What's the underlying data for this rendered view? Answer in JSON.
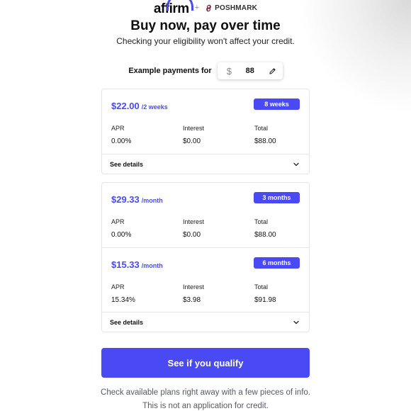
{
  "header": {
    "affirm_logo": "affirm",
    "plus": "+",
    "partner_logo": "POSHMARK",
    "title": "Buy now, pay over time",
    "subtitle": "Checking your eligibility won't affect your credit."
  },
  "example": {
    "label": "Example payments for",
    "currency_symbol": "$",
    "amount": "88"
  },
  "cards": [
    {
      "plans": [
        {
          "price": "$22.00",
          "period": "/2 weeks",
          "badge": "8 weeks",
          "apr_label": "APR",
          "apr": "0.00%",
          "interest_label": "Interest",
          "interest": "$0.00",
          "total_label": "Total",
          "total": "$88.00"
        }
      ],
      "details_label": "See details"
    },
    {
      "plans": [
        {
          "price": "$29.33",
          "period": "/month",
          "badge": "3 months",
          "apr_label": "APR",
          "apr": "0.00%",
          "interest_label": "Interest",
          "interest": "$0.00",
          "total_label": "Total",
          "total": "$88.00"
        },
        {
          "price": "$15.33",
          "period": "/month",
          "badge": "6 months",
          "apr_label": "APR",
          "apr": "15.34%",
          "interest_label": "Interest",
          "interest": "$3.98",
          "total_label": "Total",
          "total": "$91.98"
        }
      ],
      "details_label": "See details"
    }
  ],
  "cta": {
    "label": "See if you qualify"
  },
  "footnote": {
    "line1": "Check available plans right away with a few pieces of info.",
    "line2": "This is not an application for credit."
  },
  "colors": {
    "accent": "#4a4af4",
    "text": "#101820",
    "border": "#e4e6ea"
  },
  "icons": [
    "pencil-icon",
    "chevron-down-icon",
    "poshmark-icon"
  ]
}
